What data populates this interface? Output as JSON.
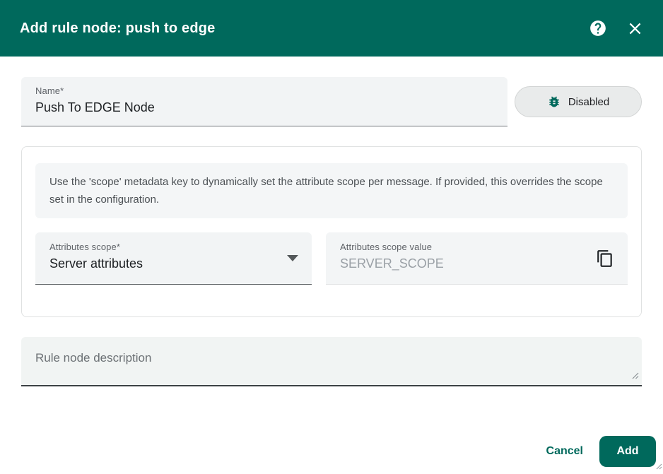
{
  "colors": {
    "accent": "#00695C",
    "header_bg": "#00695C",
    "chip_bg": "#e9ebeb",
    "field_bg": "#f2f4f5",
    "hint_bg": "#f4f6f7"
  },
  "header": {
    "title": "Add rule node: push to edge",
    "help_icon": "help-circle",
    "close_icon": "close-x"
  },
  "name_field": {
    "label": "Name*",
    "value": "Push To EDGE Node"
  },
  "debug_toggle": {
    "label": "Disabled",
    "icon": "bug"
  },
  "config": {
    "hint": "Use the 'scope' metadata key to dynamically set the attribute scope per message. If provided, this overrides the scope set in the configuration.",
    "scope_select": {
      "label": "Attributes scope*",
      "value": "Server attributes"
    },
    "scope_value": {
      "label": "Attributes scope value",
      "placeholder": "SERVER_SCOPE",
      "copy_icon": "content-copy"
    }
  },
  "description": {
    "placeholder": "Rule node description"
  },
  "footer": {
    "cancel": "Cancel",
    "add": "Add"
  }
}
